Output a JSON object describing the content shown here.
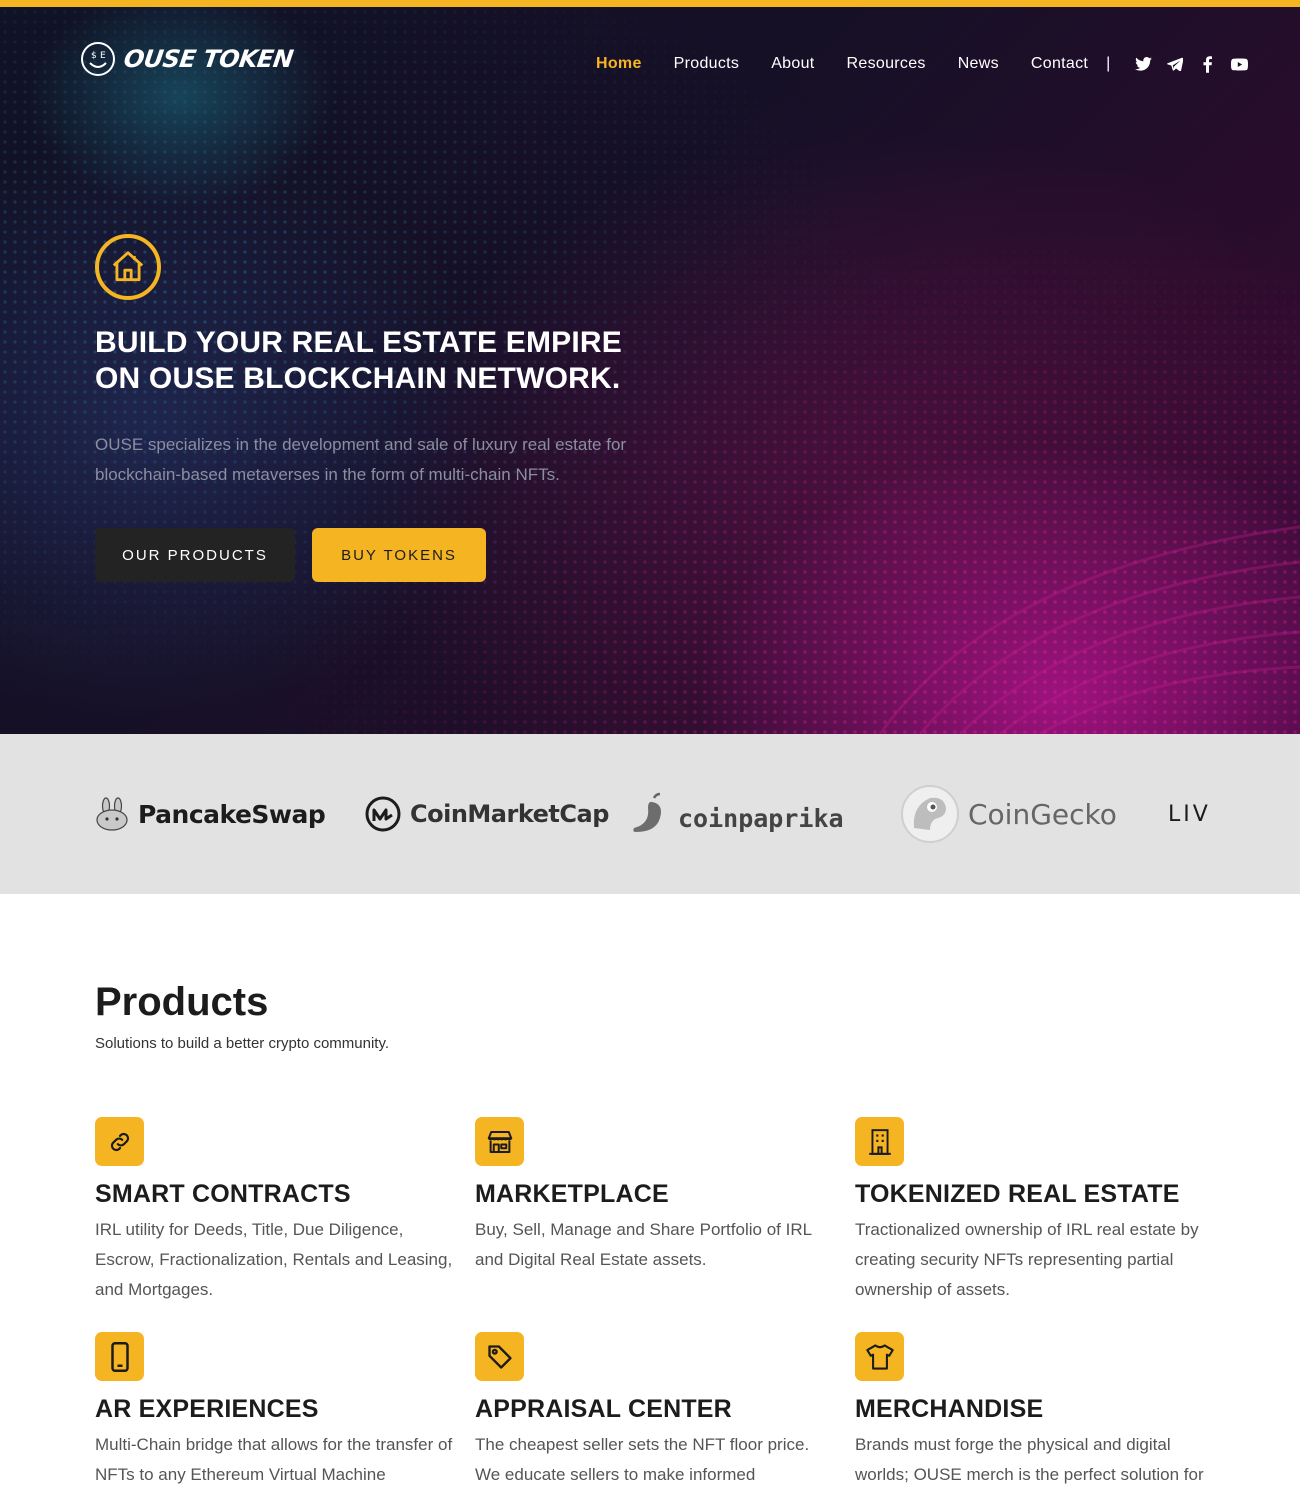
{
  "brand": {
    "name": "OUSE TOKEN",
    "accent": "#f5b422"
  },
  "nav": {
    "items": [
      {
        "label": "Home",
        "active": true
      },
      {
        "label": "Products"
      },
      {
        "label": "About"
      },
      {
        "label": "Resources"
      },
      {
        "label": "News"
      },
      {
        "label": "Contact"
      }
    ],
    "separator": "|",
    "social": [
      "twitter-icon",
      "telegram-icon",
      "facebook-icon",
      "youtube-icon"
    ]
  },
  "hero": {
    "icon": "home-icon",
    "title_line1": "BUILD YOUR REAL ESTATE EMPIRE",
    "title_line2": "ON OUSE BLOCKCHAIN NETWORK.",
    "text": "OUSE specializes in the development and sale of luxury real estate for blockchain-based metaverses in the form of multi-chain NFTs.",
    "btn_products": "OUR PRODUCTS",
    "btn_buy": "BUY TOKENS"
  },
  "partners": [
    "PancakeSwap",
    "CoinMarketCap",
    "coinpaprika",
    "CoinGecko",
    "LIV"
  ],
  "products": {
    "title": "Products",
    "subtitle": "Solutions to build a better crypto community.",
    "items": [
      {
        "icon": "link-icon",
        "title": "SMART CONTRACTS",
        "text": "IRL utility for Deeds, Title, Due Diligence, Escrow, Fractionalization, Rentals and Leasing, and Mortgages."
      },
      {
        "icon": "store-icon",
        "title": "MARKETPLACE",
        "text": "Buy, Sell, Manage and Share Portfolio of IRL and Digital Real Estate assets."
      },
      {
        "icon": "building-icon",
        "title": "TOKENIZED REAL ESTATE",
        "text": "Tractionalized ownership of IRL real estate by creating security NFTs representing partial ownership of assets."
      },
      {
        "icon": "mobile-icon",
        "title": "AR EXPERIENCES",
        "text": "Multi-Chain bridge that allows for the transfer of NFTs to any Ethereum Virtual Machine"
      },
      {
        "icon": "tag-icon",
        "title": "APPRAISAL CENTER",
        "text": "The cheapest seller sets the NFT floor price. We educate sellers to make informed"
      },
      {
        "icon": "shirt-icon",
        "title": "MERCHANDISE",
        "text": "Brands must forge the physical and digital worlds; OUSE merch is the perfect solution for"
      }
    ]
  }
}
